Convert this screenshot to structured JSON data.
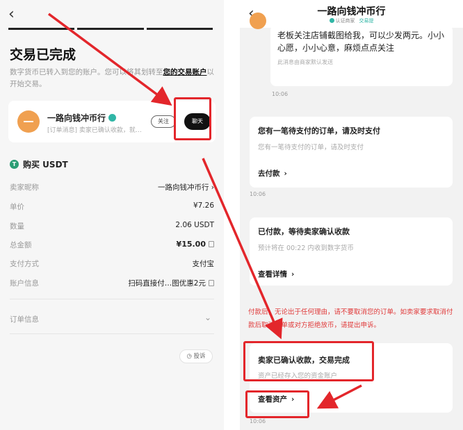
{
  "left": {
    "back_icon": "‹",
    "title": "交易已完成",
    "description_plain": "数字货币已转入到您的账户。您可以将其划转至",
    "description_link": "您的交易账户",
    "description_tail": "以开始交易。",
    "merchant": {
      "name": "一路向钱冲币行",
      "subtitle": "[订单消息] 卖家已确认收款，就…",
      "follow_label": "关注",
      "chat_label": "聊天"
    },
    "section_title": "购买 USDT",
    "usdt_icon": "T",
    "rows": [
      {
        "label": "卖家昵称",
        "value": "一路向钱冲币行 ›"
      },
      {
        "label": "单价",
        "value": "¥7.26"
      },
      {
        "label": "数量",
        "value": "2.06 USDT"
      },
      {
        "label": "总金额",
        "value": "¥15.00"
      },
      {
        "label": "支付方式",
        "value": "支付宝"
      },
      {
        "label": "账户信息",
        "value": "扫码直接付…图优惠2元"
      }
    ],
    "order_info_label": "订单信息",
    "order_info_chevron": "⌄",
    "complaint_label": "◷ 投诉"
  },
  "right": {
    "header": {
      "back_icon": "‹",
      "title": "一路向钱冲币行",
      "badge_verified": "认证商家",
      "badge_deposit": "交易提"
    },
    "message1": {
      "text": "老板关注店铺截图给我，可以少发两元。小小心愿，小小心意，麻烦点点关注",
      "note": "此消息由商家默认发送",
      "time": "10:06"
    },
    "card_pending": {
      "title": "您有一笔待支付的订单，请及时支付",
      "subtitle": "您有一笔待支付的订单，请及时支付",
      "link": "去付款",
      "time": "10:06"
    },
    "card_paid": {
      "title": "已付款，等待卖家确认收款",
      "subtitle": "预计将在 00:22 内收到数字货币",
      "link": "查看详情"
    },
    "warning": "付款后，无论出于任何理由，请不要取消您的订单。如卖家要求取消付款后取消订单或对方拒绝放币，请提出申诉。",
    "card_confirmed": {
      "title": "卖家已确认收款，交易完成",
      "subtitle": "资产已经存入您的资金账户",
      "link": "查看资产",
      "time": "10:06"
    },
    "chevron": "›"
  },
  "colors": {
    "annotation": "#e3262b",
    "accent_teal": "#30b6a6",
    "avatar_orange": "#f0a050",
    "warning_red": "#e03a3a"
  }
}
